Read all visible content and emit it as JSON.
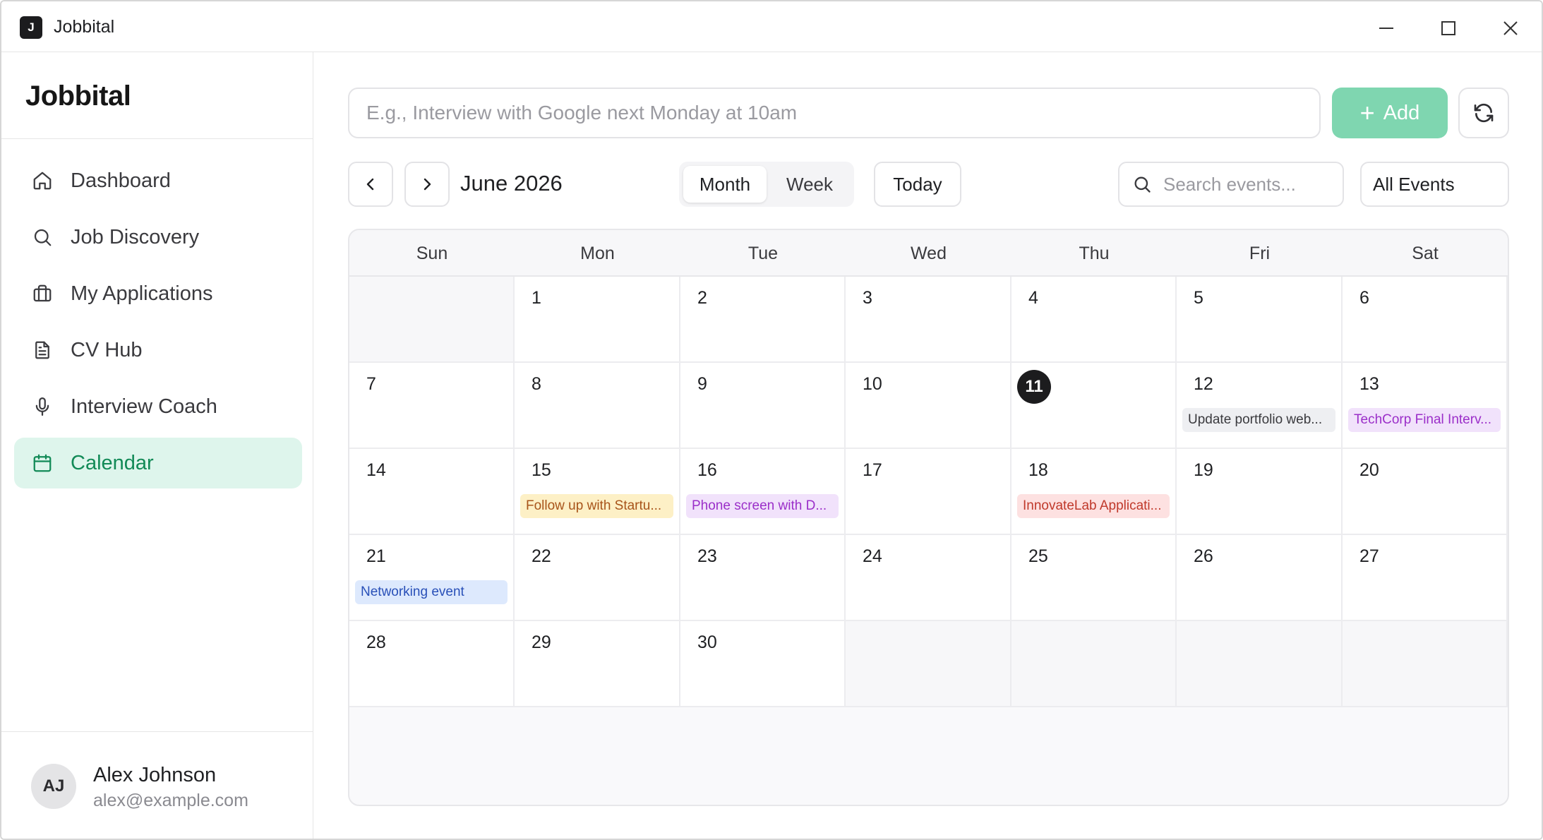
{
  "window": {
    "title": "Jobbital",
    "app_icon_letter": "J"
  },
  "sidebar": {
    "brand": "Jobbital",
    "items": [
      {
        "label": "Dashboard",
        "icon": "home-icon",
        "active": false
      },
      {
        "label": "Job Discovery",
        "icon": "search-icon",
        "active": false
      },
      {
        "label": "My Applications",
        "icon": "briefcase-icon",
        "active": false
      },
      {
        "label": "CV Hub",
        "icon": "document-icon",
        "active": false
      },
      {
        "label": "Interview Coach",
        "icon": "microphone-icon",
        "active": false
      },
      {
        "label": "Calendar",
        "icon": "calendar-icon",
        "active": true
      }
    ],
    "user": {
      "initials": "AJ",
      "name": "Alex Johnson",
      "email": "alex@example.com"
    }
  },
  "toolbar": {
    "quick_add_placeholder": "E.g., Interview with Google next Monday at 10am",
    "add_label": "Add",
    "month_title": "June 2026",
    "view_month": "Month",
    "view_week": "Week",
    "active_view": "Month",
    "today_label": "Today",
    "search_placeholder": "Search events...",
    "filter_value": "All Events"
  },
  "colors": {
    "accent": "#128a57",
    "accent_light": "#def5ec",
    "add_button": "#7fd6b0"
  },
  "calendar": {
    "weekdays": [
      "Sun",
      "Mon",
      "Tue",
      "Wed",
      "Thu",
      "Fri",
      "Sat"
    ],
    "today": 11,
    "weeks": [
      [
        null,
        {
          "day": 1
        },
        {
          "day": 2
        },
        {
          "day": 3
        },
        {
          "day": 4
        },
        {
          "day": 5
        },
        {
          "day": 6
        }
      ],
      [
        {
          "day": 7
        },
        {
          "day": 8
        },
        {
          "day": 9
        },
        {
          "day": 10
        },
        {
          "day": 11
        },
        {
          "day": 12,
          "event": {
            "title": "Update portfolio web...",
            "bg": "#eeeff2",
            "color": "#3a3a3e"
          }
        },
        {
          "day": 13,
          "event": {
            "title": "TechCorp Final Interv...",
            "bg": "#f1e2fb",
            "color": "#9b2fc9"
          }
        }
      ],
      [
        {
          "day": 14
        },
        {
          "day": 15,
          "event": {
            "title": "Follow up with Startu...",
            "bg": "#fdf0c6",
            "color": "#a8541a"
          }
        },
        {
          "day": 16,
          "event": {
            "title": "Phone screen with D...",
            "bg": "#f1e2fb",
            "color": "#9b2fc9"
          }
        },
        {
          "day": 17
        },
        {
          "day": 18,
          "event": {
            "title": "InnovateLab Applicati...",
            "bg": "#fde1e1",
            "color": "#c0392b"
          }
        },
        {
          "day": 19
        },
        {
          "day": 20
        }
      ],
      [
        {
          "day": 21,
          "event": {
            "title": "Networking event",
            "bg": "#dde9fd",
            "color": "#2950b8"
          }
        },
        {
          "day": 22
        },
        {
          "day": 23
        },
        {
          "day": 24
        },
        {
          "day": 25
        },
        {
          "day": 26
        },
        {
          "day": 27
        }
      ],
      [
        {
          "day": 28
        },
        {
          "day": 29
        },
        {
          "day": 30
        },
        null,
        null,
        null,
        null
      ]
    ]
  }
}
